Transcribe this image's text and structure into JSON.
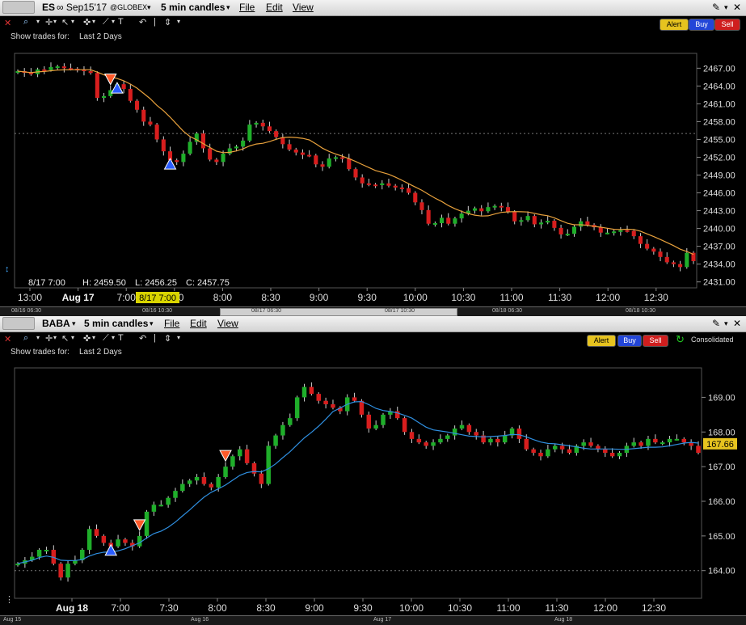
{
  "top": {
    "symbol": "ES",
    "contract": "∞ Sep15'17",
    "exchange": "@GLOBEX",
    "timeframe": "5 min candles",
    "menus": [
      "File",
      "Edit",
      "View"
    ],
    "show_trades_label": "Show trades for:",
    "show_trades_value": "Last 2 Days",
    "buttons": {
      "alert": "Alert",
      "buy": "Buy",
      "sell": "Sell"
    },
    "info": {
      "date": "8/17 7:00",
      "high": "H: 2459.50",
      "low": "L: 2456.25",
      "close": "C: 2457.75"
    },
    "x_cursor_label": "8/17 7:00",
    "scroll_labels": [
      "08/16 06:30",
      "08/16 10:30",
      "08/17 06:30",
      "08/17 10:30",
      "08/18 06:30",
      "08/18 10:30"
    ]
  },
  "bottom": {
    "symbol": "BABA",
    "timeframe": "5 min candles",
    "menus": [
      "File",
      "Edit",
      "View"
    ],
    "show_trades_label": "Show trades for:",
    "show_trades_value": "Last 2 Days",
    "buttons": {
      "alert": "Alert",
      "buy": "Buy",
      "sell": "Sell",
      "consolidated": "Consolidated"
    },
    "last_price_label": "167.66",
    "scroll_labels": [
      "Aug 15",
      "Aug 16",
      "Aug 17",
      "Aug 18"
    ]
  },
  "colors": {
    "up": "#1fae2a",
    "down": "#d81e1e",
    "ma_top": "#e8a13c",
    "ma_bottom": "#2f8fe0",
    "grid": "#3a3a3a",
    "axis_text": "#dddddd",
    "date_label": "#f2f2f2",
    "buy_marker": "#2a5cff",
    "sell_marker": "#ff5a2a"
  },
  "chart_data": [
    {
      "type": "candlestick",
      "title": "ES ∞ Sep15'17 5 min candles",
      "x_ticks": [
        "13:00",
        "Aug 17",
        "7:00",
        "7:30",
        "8:00",
        "8:30",
        "9:00",
        "9:30",
        "10:00",
        "10:30",
        "11:00",
        "11:30",
        "12:00",
        "12:30"
      ],
      "y_ticks": [
        2467.0,
        2464.0,
        2461.0,
        2458.0,
        2455.0,
        2452.0,
        2449.0,
        2446.0,
        2443.0,
        2440.0,
        2437.0,
        2434.0,
        2431.0
      ],
      "ylim": [
        2430.0,
        2469.5
      ],
      "close": [
        2466.5,
        2466.25,
        2466.0,
        2466.8,
        2466.7,
        2467.2,
        2467.3,
        2467.0,
        2466.9,
        2466.8,
        2466.5,
        2466.2,
        2462.0,
        2462.3,
        2463.3,
        2464.3,
        2463.5,
        2461.5,
        2460.0,
        2458.0,
        2457.5,
        2455.0,
        2453.0,
        2451.5,
        2451.2,
        2452.6,
        2454.6,
        2456.0,
        2453.5,
        2451.6,
        2451.2,
        2452.6,
        2453.5,
        2453.8,
        2454.8,
        2457.5,
        2457.8,
        2457.2,
        2456.4,
        2455.4,
        2454.2,
        2453.3,
        2452.8,
        2452.4,
        2452.3,
        2450.8,
        2450.4,
        2451.8,
        2452.0,
        2451.8,
        2450.0,
        2448.6,
        2447.6,
        2447.4,
        2447.3,
        2447.6,
        2447.2,
        2446.9,
        2446.8,
        2446.0,
        2444.4,
        2443.1,
        2440.8,
        2440.9,
        2441.8,
        2440.8,
        2441.7,
        2442.5,
        2443.0,
        2443.4,
        2442.9,
        2443.6,
        2443.8,
        2443.6,
        2442.8,
        2441.2,
        2441.4,
        2442.1,
        2440.7,
        2441.0,
        2441.3,
        2440.1,
        2439.0,
        2439.1,
        2440.3,
        2441.2,
        2440.6,
        2440.2,
        2439.3,
        2439.3,
        2439.5,
        2439.7,
        2439.6,
        2438.7,
        2437.4,
        2436.6,
        2436.1,
        2435.2,
        2434.3,
        2434.0,
        2433.5,
        2435.9,
        2434.5
      ],
      "series": [
        {
          "name": "moving average"
        }
      ],
      "markers": [
        {
          "type": "sell",
          "x_index": 14
        },
        {
          "type": "buy",
          "x_index": 15
        },
        {
          "type": "buy",
          "x_index": 23
        }
      ],
      "last_value": 2434.5
    },
    {
      "type": "candlestick",
      "title": "BABA 5 min candles",
      "x_ticks": [
        "Aug 18",
        "7:00",
        "7:30",
        "8:00",
        "8:30",
        "9:00",
        "9:30",
        "10:00",
        "10:30",
        "11:00",
        "11:30",
        "12:00",
        "12:30"
      ],
      "y_ticks": [
        169.0,
        168.0,
        167.0,
        166.0,
        165.0,
        164.0
      ],
      "ylim": [
        163.2,
        169.85
      ],
      "close": [
        164.2,
        164.3,
        164.4,
        164.6,
        164.6,
        164.2,
        163.8,
        164.2,
        164.3,
        164.6,
        165.2,
        165.0,
        164.8,
        164.7,
        164.9,
        164.8,
        164.7,
        165.0,
        165.7,
        165.9,
        165.9,
        166.1,
        166.3,
        166.5,
        166.6,
        166.7,
        166.5,
        166.4,
        166.7,
        167.0,
        167.3,
        167.5,
        167.1,
        166.8,
        166.5,
        167.6,
        167.9,
        168.2,
        168.4,
        169.0,
        169.3,
        169.1,
        168.9,
        168.8,
        168.7,
        168.6,
        169.0,
        168.9,
        168.5,
        168.1,
        168.2,
        168.5,
        168.6,
        168.4,
        168.0,
        167.8,
        167.7,
        167.6,
        167.7,
        167.8,
        167.9,
        168.1,
        168.2,
        168.0,
        167.9,
        167.7,
        167.8,
        167.7,
        167.9,
        168.1,
        167.8,
        167.5,
        167.4,
        167.3,
        167.5,
        167.6,
        167.5,
        167.4,
        167.6,
        167.7,
        167.6,
        167.5,
        167.4,
        167.3,
        167.4,
        167.6,
        167.7,
        167.6,
        167.8,
        167.7,
        167.7,
        167.8,
        167.8,
        167.7,
        167.6,
        167.4
      ],
      "series": [
        {
          "name": "moving average"
        }
      ],
      "markers": [
        {
          "type": "buy",
          "x_index": 13
        },
        {
          "type": "sell",
          "x_index": 17
        },
        {
          "type": "sell",
          "x_index": 29
        }
      ],
      "last_value": 167.66
    }
  ]
}
